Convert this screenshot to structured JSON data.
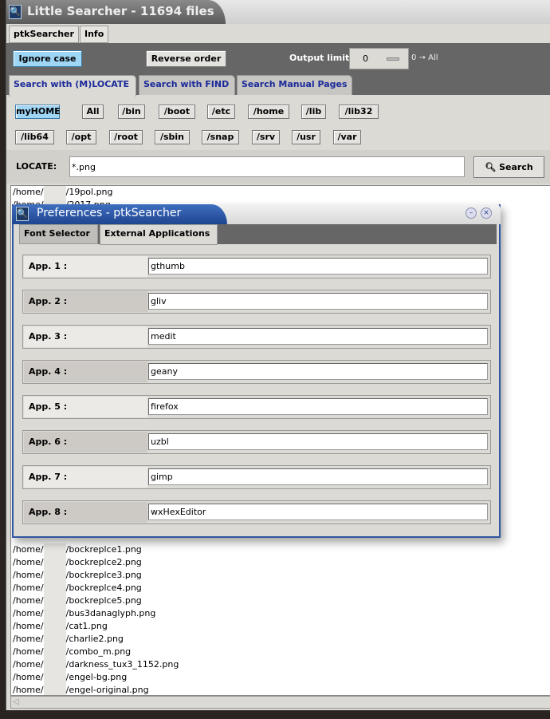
{
  "window": {
    "title": "Little Searcher - 11694 files"
  },
  "menu": [
    "ptkSearcher",
    "Info"
  ],
  "toolbar": {
    "ignore_case": "Ignore case",
    "reverse_order": "Reverse order",
    "output_limit_label": "Output limit",
    "output_limit_value": "0",
    "output_limit_hint": "0 → All"
  },
  "tabs": [
    "Search with (M)LOCATE",
    "Search with FIND",
    "Search Manual Pages"
  ],
  "dirs_row1": [
    "myHOME",
    "All",
    "/bin",
    "/boot",
    "/etc",
    "/home",
    "/lib",
    "/lib32"
  ],
  "dirs_row2": [
    "/lib64",
    "/opt",
    "/root",
    "/sbin",
    "/snap",
    "/srv",
    "/usr",
    "/var"
  ],
  "locate": {
    "label": "LOCATE:",
    "value": "*.png",
    "search_button": "Search"
  },
  "results_top": [
    {
      "dir": "/home/",
      "file": "/19pol.png"
    },
    {
      "dir": "/home/",
      "file": "/2017.png"
    }
  ],
  "results_bottom": [
    {
      "dir": "/home/",
      "file": "/bockreplce1.png"
    },
    {
      "dir": "/home/",
      "file": "/bockreplce2.png"
    },
    {
      "dir": "/home/",
      "file": "/bockreplce3.png"
    },
    {
      "dir": "/home/",
      "file": "/bockreplce4.png"
    },
    {
      "dir": "/home/",
      "file": "/bockreplce5.png"
    },
    {
      "dir": "/home/",
      "file": "/bus3danaglyph.png"
    },
    {
      "dir": "/home/",
      "file": "/cat1.png"
    },
    {
      "dir": "/home/",
      "file": "/charlie2.png"
    },
    {
      "dir": "/home/",
      "file": "/combo_m.png"
    },
    {
      "dir": "/home/",
      "file": "/darkness_tux3_1152.png"
    },
    {
      "dir": "/home/",
      "file": "/engel-bg.png"
    },
    {
      "dir": "/home/",
      "file": "/engel-original.png"
    }
  ],
  "dialog": {
    "title": "Preferences - ptkSearcher",
    "tabs": [
      "Font Selector",
      "External Applications"
    ],
    "apps": [
      {
        "label": "App. 1 :",
        "value": "gthumb"
      },
      {
        "label": "App. 2 :",
        "value": "gliv"
      },
      {
        "label": "App. 3 :",
        "value": "medit"
      },
      {
        "label": "App. 4 :",
        "value": "geany"
      },
      {
        "label": "App. 5 :",
        "value": "firefox"
      },
      {
        "label": "App. 6 :",
        "value": "uzbl"
      },
      {
        "label": "App. 7 :",
        "value": "gimp"
      },
      {
        "label": "App. 8 :",
        "value": "wxHexEditor"
      }
    ]
  },
  "colors": {
    "active_button": "#9fd5f5",
    "tab_text": "#1a2a9a",
    "dialog_title": "#2f56a0"
  }
}
